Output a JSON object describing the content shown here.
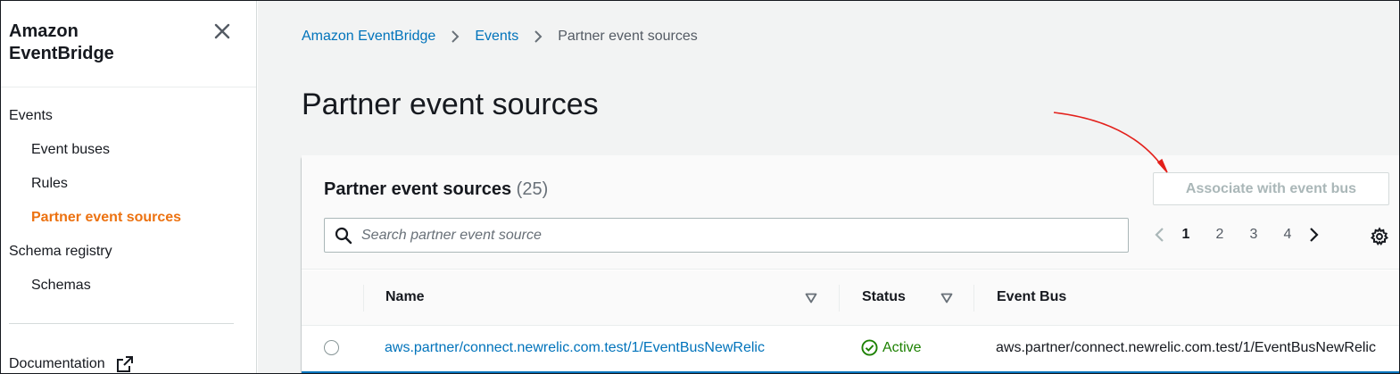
{
  "sidebar": {
    "title": "Amazon EventBridge",
    "items": [
      {
        "label": "Events",
        "level": "top",
        "active": false
      },
      {
        "label": "Event buses",
        "level": "sub",
        "active": false
      },
      {
        "label": "Rules",
        "level": "sub",
        "active": false
      },
      {
        "label": "Partner event sources",
        "level": "sub",
        "active": true
      },
      {
        "label": "Schema registry",
        "level": "top",
        "active": false
      },
      {
        "label": "Schemas",
        "level": "sub",
        "active": false
      }
    ],
    "documentation_label": "Documentation"
  },
  "breadcrumb": {
    "items": [
      "Amazon EventBridge",
      "Events"
    ],
    "current": "Partner event sources"
  },
  "page": {
    "title": "Partner event sources"
  },
  "panel": {
    "title": "Partner event sources",
    "count": "(25)",
    "associate_button": "Associate with event bus",
    "search_placeholder": "Search partner event source",
    "pages": [
      "1",
      "2",
      "3",
      "4"
    ],
    "current_page": "1"
  },
  "table": {
    "columns": [
      "Name",
      "Status",
      "Event Bus"
    ],
    "rows": [
      {
        "name": "aws.partner/connect.newrelic.com.test/1/EventBusNewRelic",
        "status": "Active",
        "event_bus": "aws.partner/connect.newrelic.com.test/1/EventBusNewRelic"
      }
    ]
  },
  "colors": {
    "link": "#0073bb",
    "active_nav": "#ec7211",
    "status_active": "#1d8102",
    "annotation_arrow": "#e3201b"
  }
}
